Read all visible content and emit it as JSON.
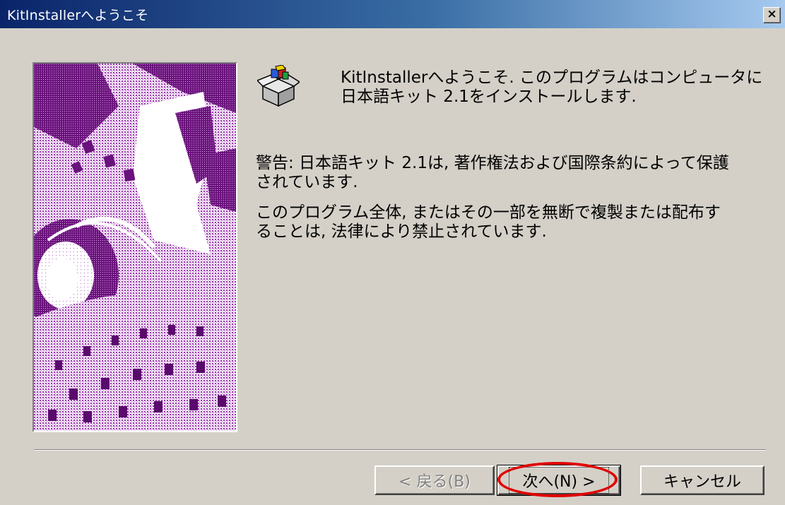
{
  "window": {
    "title": "KitInstallerへようこそ",
    "close_label": "×"
  },
  "content": {
    "intro_line1": "KitInstallerへようこそ. このプログラムはコンピュータに",
    "intro_line2": "日本語キット 2.1をインストールします.",
    "warning_line1": "警告: 日本語キット 2.1は, 著作権法および国際条約によって保護",
    "warning_line2": "されています.",
    "prohibit_line1": "このプログラム全体, またはその一部を無断で複製または配布す",
    "prohibit_line2": "ることは, 法律により禁止されています."
  },
  "buttons": {
    "back_label": "< 戻る(B)",
    "next_label": "次へ(N) >",
    "cancel_label": "キャンセル"
  },
  "colors": {
    "titlebar_start": "#0a246a",
    "titlebar_end": "#a6caf0",
    "dialog_bg": "#d4d0c8",
    "highlight_ring": "#e00000",
    "artwork_purple": "#7a1a8c"
  },
  "icons": {
    "package": "setup-package-icon",
    "close": "close-icon"
  }
}
